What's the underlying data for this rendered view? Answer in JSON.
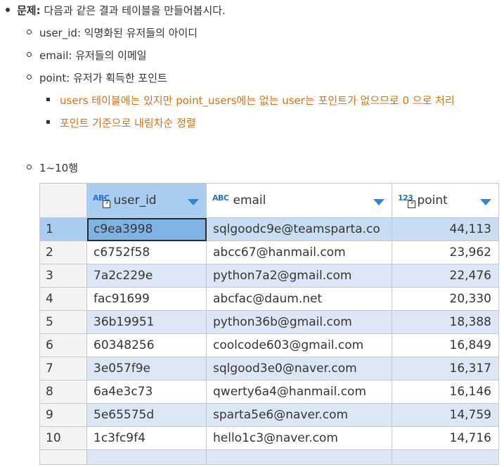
{
  "problem": {
    "label": "문제:",
    "text": " 다음과 같은 결과 테이블을 만들어봅시다."
  },
  "fields": [
    {
      "name": "user_id",
      "desc": ": 익명화된 유저들의 아이디"
    },
    {
      "name": "email",
      "desc": ": 유저들의 이메일"
    },
    {
      "name": "point",
      "desc": ": 유저가 획득한 포인트"
    }
  ],
  "notes": [
    "users 테이블에는 있지만 point_users에는 없는 user는 포인트가 없으므로 0 으로 처리",
    "포인트 기준으로 내림차순 정렬"
  ],
  "rows_label": "1~10행",
  "table": {
    "columns": [
      {
        "type_icon": "ABC",
        "label": "user_id"
      },
      {
        "type_icon": "ABC",
        "label": "email"
      },
      {
        "type_icon": "123",
        "label": "point"
      }
    ],
    "rows": [
      {
        "n": "1",
        "user_id": "c9ea3998",
        "email": "sqlgoodc9e@teamsparta.co",
        "point": "44,113"
      },
      {
        "n": "2",
        "user_id": "c6752f58",
        "email": "abcc67@hanmail.com",
        "point": "23,962"
      },
      {
        "n": "3",
        "user_id": "7a2c229e",
        "email": "python7a2@gmail.com",
        "point": "22,476"
      },
      {
        "n": "4",
        "user_id": "fac91699",
        "email": "abcfac@daum.net",
        "point": "20,330"
      },
      {
        "n": "5",
        "user_id": "36b19951",
        "email": "python36b@gmail.com",
        "point": "18,388"
      },
      {
        "n": "6",
        "user_id": "60348256",
        "email": "coolcode603@gmail.com",
        "point": "16,849"
      },
      {
        "n": "7",
        "user_id": "3e057f9e",
        "email": "sqlgood3e0@naver.com",
        "point": "16,317"
      },
      {
        "n": "8",
        "user_id": "6a4e3c73",
        "email": "qwerty6a4@hanmail.com",
        "point": "16,146"
      },
      {
        "n": "9",
        "user_id": "5e65575d",
        "email": "sparta5e6@naver.com",
        "point": "14,759"
      },
      {
        "n": "10",
        "user_id": "1c3fc9f4",
        "email": "hello1c3@naver.com",
        "point": "14,716"
      }
    ]
  }
}
